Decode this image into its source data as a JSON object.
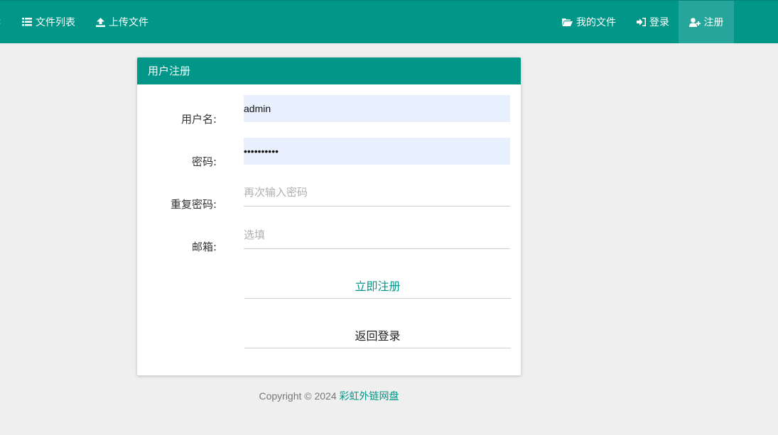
{
  "nav": {
    "left_items": [
      {
        "label": "文件列表",
        "icon": "list-icon"
      },
      {
        "label": "上传文件",
        "icon": "upload-icon"
      }
    ],
    "right_items": [
      {
        "label": "我的文件",
        "icon": "folder-open-icon"
      },
      {
        "label": "登录",
        "icon": "sign-in-icon"
      },
      {
        "label": "注册",
        "icon": "user-plus-icon",
        "active": true
      }
    ]
  },
  "panel": {
    "title": "用户注册"
  },
  "form": {
    "username": {
      "label": "用户名:",
      "value": "admin"
    },
    "password": {
      "label": "密码:",
      "value": "••••••••••"
    },
    "confirm_password": {
      "label": "重复密码:",
      "placeholder": "再次输入密码"
    },
    "email": {
      "label": "邮箱:",
      "placeholder": "选填"
    }
  },
  "buttons": {
    "register_label": "立即注册",
    "back_label": "返回登录"
  },
  "footer": {
    "copyright": "Copyright © 2024",
    "site_name": "彩虹外链网盘"
  },
  "colors": {
    "brand": "#009688",
    "nav_active": "#26a69a",
    "autofill": "#e8f0fe",
    "background": "#efefef"
  }
}
